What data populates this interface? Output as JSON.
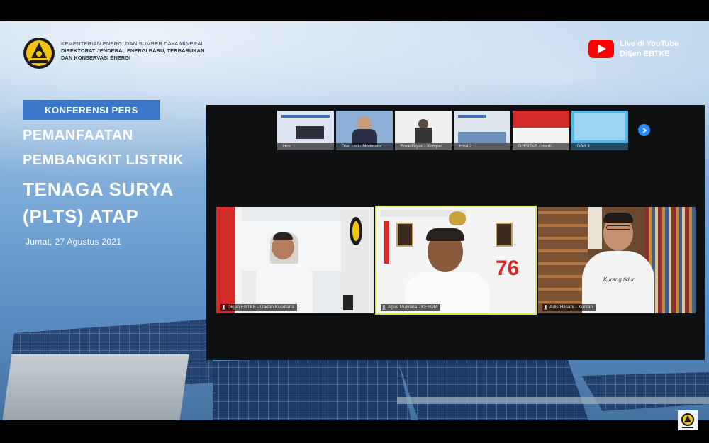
{
  "ministry": {
    "line1": "KEMENTERIAN ENERGI DAN SUMBER DAYA MINERAL",
    "line2": "DIREKTORAT JENDERAL ENERGI BARU, TERBARUKAN",
    "line3": "DAN KONSERVASI ENERGI"
  },
  "youtube": {
    "line1": "Live di YouTube",
    "line2": "Ditjen EBTKE"
  },
  "title": {
    "badge": "KONFERENSI PERS",
    "line1": "PEMANFAATAN",
    "line2": "PEMBANGKIT LISTRIK",
    "line3": "TENAGA SURYA",
    "line4": "(PLTS) ATAP",
    "date": "Jumat, 27 Agustus 2021"
  },
  "thumbnails": [
    {
      "label": "Host 1"
    },
    {
      "label": "Dian Lori - Moderator"
    },
    {
      "label": "Emai Firyan - Kumpar..."
    },
    {
      "label": "Host 2"
    },
    {
      "label": "DJEBTKE - Hardi..."
    },
    {
      "label": "DBR 3"
    }
  ],
  "participants": [
    {
      "label": "Dirjen EBTKE - Dadan Kusdiana"
    },
    {
      "label": "Agus Mulyana - KESDM"
    },
    {
      "label": "Adis Hasani - Kontan"
    }
  ],
  "colors": {
    "badge": "#3a77c9",
    "youtube_red": "#ff0000",
    "active_speaker": "#d9e15a"
  }
}
